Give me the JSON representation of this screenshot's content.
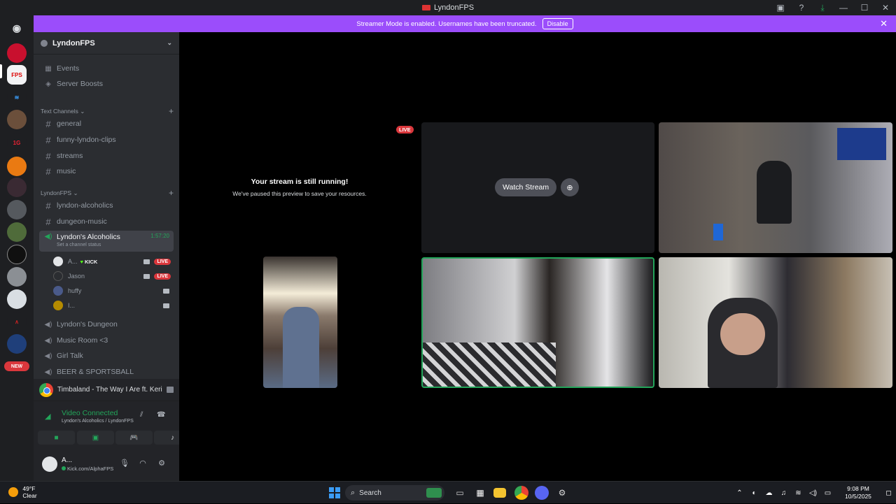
{
  "window": {
    "title": "LyndonFPS"
  },
  "banner": {
    "text": "Streamer Mode is enabled. Usernames have been truncated.",
    "disable_label": "Disable"
  },
  "server": {
    "name": "LyndonFPS",
    "items": [
      {
        "label": "Events",
        "icon": "calendar-icon"
      },
      {
        "label": "Server Boosts",
        "icon": "boost-icon"
      }
    ],
    "text_category": "Text Channels",
    "text_channels": [
      "general",
      "funny-lyndon-clips",
      "streams",
      "music"
    ],
    "lyndon_category": "LyndonFPS",
    "lyndon_channels": [
      "lyndon-alcoholics",
      "dungeon-music"
    ],
    "active_voice": {
      "name": "Lyndon's Alcoholics",
      "status": "Set a channel status",
      "timer": "1:57:20",
      "users": [
        {
          "name": "A...",
          "tag": "KICK",
          "live": "LIVE"
        },
        {
          "name": "Jason",
          "live": "LIVE"
        },
        {
          "name": "huffy"
        },
        {
          "name": "I..."
        }
      ]
    },
    "voice_channels": [
      "Lyndon's Dungeon",
      "Music Room <3",
      "Girl Talk",
      "BEER & SPORTSBALL"
    ]
  },
  "rail": {
    "new_badge": "NEW"
  },
  "activity": {
    "text": "Timbaland - The Way I Are ft. Keri Hil..."
  },
  "voice_panel": {
    "status": "Video Connected",
    "channel": "Lyndon's Alcoholics / LyndonFPS"
  },
  "user_panel": {
    "name": "A...",
    "status": "Kick.com/AlphaFPS"
  },
  "stage": {
    "paused_title": "Your stream is still running!",
    "paused_sub": "We've paused this preview to save your resources.",
    "live_label": "LIVE",
    "watch_label": "Watch Stream"
  },
  "taskbar": {
    "temp": "49°F",
    "condition": "Clear",
    "search_placeholder": "Search",
    "time": "9:08 PM",
    "date": "10/5/2025"
  },
  "colors": {
    "banner": "#9b4dfb",
    "live": "#da373c",
    "connected": "#23a55a"
  }
}
